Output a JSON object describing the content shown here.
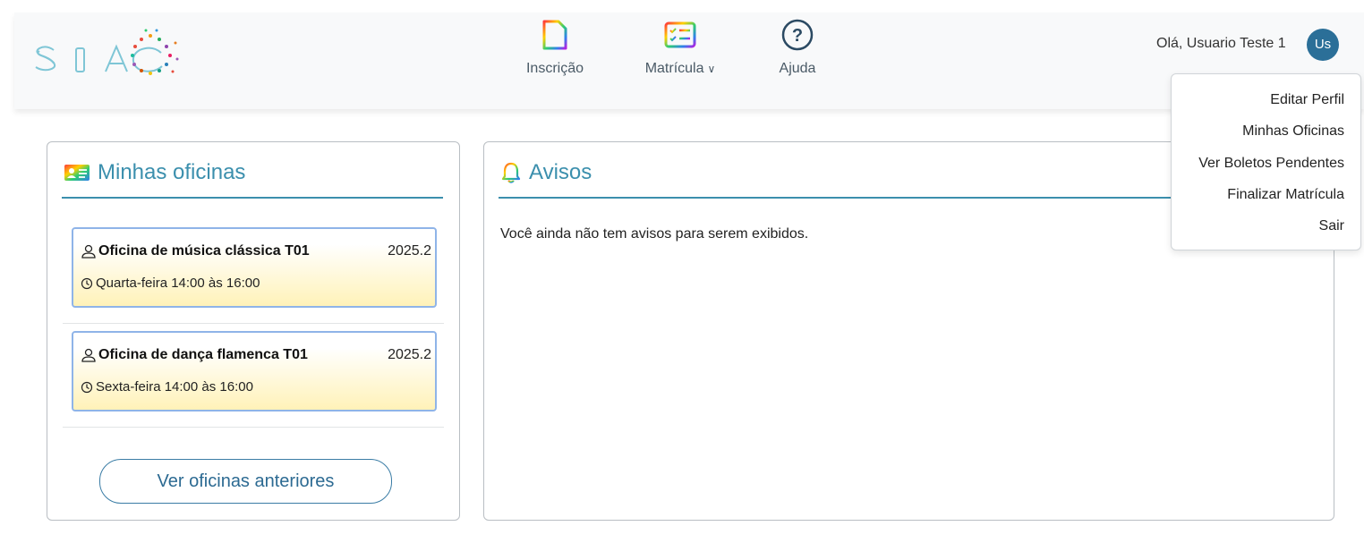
{
  "app": {
    "logo_text": "SIAC"
  },
  "nav": {
    "items": [
      {
        "label": "Inscrição",
        "icon": "document-icon"
      },
      {
        "label": "Matrícula",
        "icon": "checklist-icon",
        "has_dropdown": true
      },
      {
        "label": "Ajuda",
        "icon": "help-icon"
      }
    ]
  },
  "user": {
    "greeting": "Olá, Usuario Teste 1",
    "avatar_initials": "Us",
    "menu": [
      "Editar Perfil",
      "Minhas Oficinas",
      "Ver Boletos Pendentes",
      "Finalizar Matrícula",
      "Sair"
    ]
  },
  "minhas_oficinas": {
    "title": "Minhas oficinas",
    "workshops": [
      {
        "name": "Oficina de música clássica T01",
        "period": "2025.2",
        "schedule": "Quarta-feira 14:00 às 16:00"
      },
      {
        "name": "Oficina de dança flamenca T01",
        "period": "2025.2",
        "schedule": "Sexta-feira 14:00 às 16:00"
      }
    ],
    "previous_button": "Ver oficinas anteriores"
  },
  "avisos": {
    "title": "Avisos",
    "empty_message": "Você ainda não tem avisos para serem exibidos."
  },
  "colors": {
    "accent": "#3b8fad",
    "avatar_bg": "#2b6f98",
    "card_border_blue": "#8fb4e8",
    "card_gradient_yellow": "#fff2b8"
  }
}
